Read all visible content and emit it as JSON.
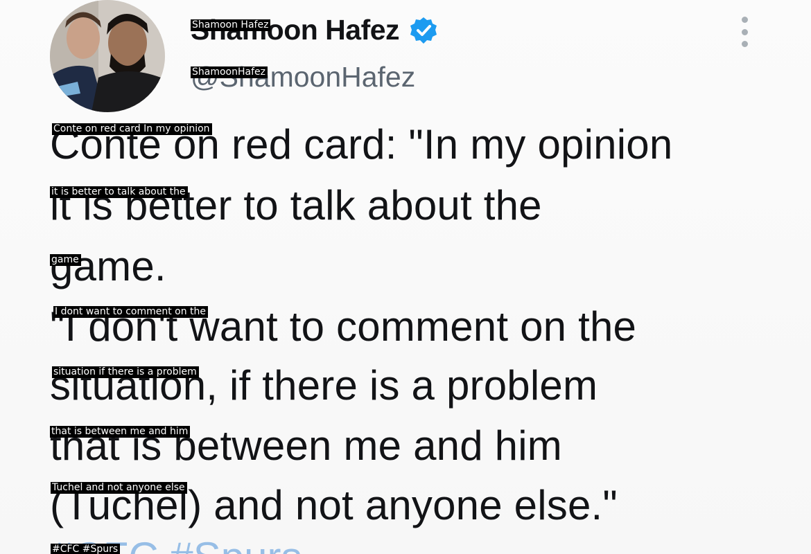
{
  "author": {
    "display_name": "Shamoon Hafez",
    "handle": "@ShamoonHafez",
    "verified_icon": "verified-badge-icon",
    "verified_color": "#1d9bf0",
    "more_icon": "more-vertical-icon"
  },
  "tweet": {
    "lines": [
      "Conte on red card: \"In my opinion",
      "it is better to talk about the",
      "game.",
      "\"I don't want to comment on the",
      "situation, if there is a problem",
      "that is between me and him",
      "(Tuchel) and not anyone else.\""
    ],
    "hashtags": "#CFC #Spurs"
  },
  "overlays": {
    "name": "Shamoon Hafez",
    "handle": "ShamoonHafez",
    "line1": "Conte on red card In my opinion",
    "line2": "it is better to talk about the",
    "line3": "game",
    "line4": "I dont want to comment on the",
    "line5": "situation if there is a problem",
    "line6": "that is between me and him",
    "line7": "Tuchel and not anyone else",
    "hashtags": "#CFC #Spurs"
  },
  "colors": {
    "text": "#121316",
    "handle": "#5b6570",
    "hashtag": "#4a90d9",
    "overlay_bg": "#000000",
    "overlay_text": "#ffffff"
  }
}
